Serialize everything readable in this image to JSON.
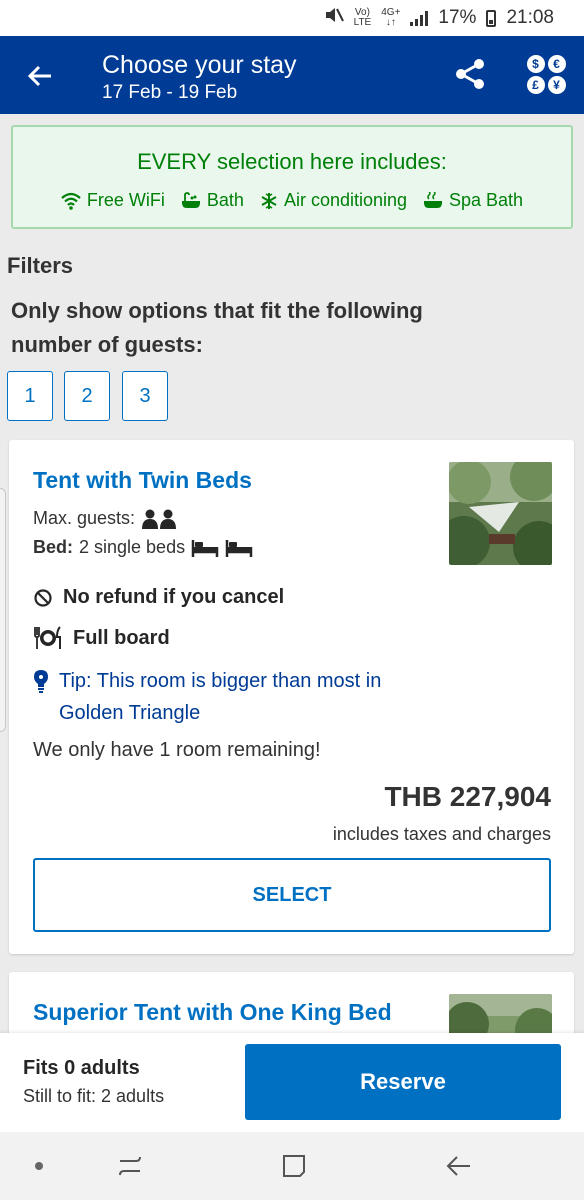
{
  "status_bar": {
    "volte_top": "Vo)",
    "volte_bottom": "LTE",
    "network_top": "4G+",
    "network_bottom": "↓↑",
    "battery": "17%",
    "time": "21:08"
  },
  "header": {
    "title": "Choose your stay",
    "dates": "17 Feb - 19 Feb",
    "back_icon": "arrow-left-icon",
    "share_icon": "share-icon",
    "currency_icon": "currency-icon",
    "currency_symbols": [
      "$",
      "€",
      "£",
      "¥"
    ]
  },
  "amenities": {
    "heading": "EVERY selection here includes:",
    "items": [
      {
        "icon": "wifi-icon",
        "label": "Free WiFi"
      },
      {
        "icon": "bath-icon",
        "label": "Bath"
      },
      {
        "icon": "snowflake-icon",
        "label": "Air conditioning"
      },
      {
        "icon": "spa-bath-icon",
        "label": "Spa Bath"
      }
    ]
  },
  "filters": {
    "title": "Filters",
    "description": "Only show options that fit the following number of guests:",
    "guest_options": [
      "1",
      "2",
      "3"
    ]
  },
  "rooms": [
    {
      "name": "Tent with Twin Beds",
      "max_guests_label": "Max. guests:",
      "bed_label": "Bed:",
      "bed_value": "2 single beds",
      "cancellation": "No refund if you cancel",
      "meal": "Full board",
      "tip": "Tip: This room is bigger than most in Golden Triangle",
      "availability": "We only have 1 room remaining!",
      "price": "THB 227,904",
      "price_note": "includes taxes and charges",
      "select_label": "SELECT"
    },
    {
      "name": "Superior Tent with One King Bed"
    }
  ],
  "bottom_bar": {
    "fits_title": "Fits 0 adults",
    "fits_sub": "Still to fit: 2 adults",
    "reserve_label": "Reserve"
  },
  "nav_bar": {
    "icons": [
      "dot-icon",
      "recents-icon",
      "home-icon",
      "back-icon"
    ]
  },
  "colors": {
    "brand_blue": "#003b95",
    "action_blue": "#0071c2",
    "green": "#008009"
  }
}
